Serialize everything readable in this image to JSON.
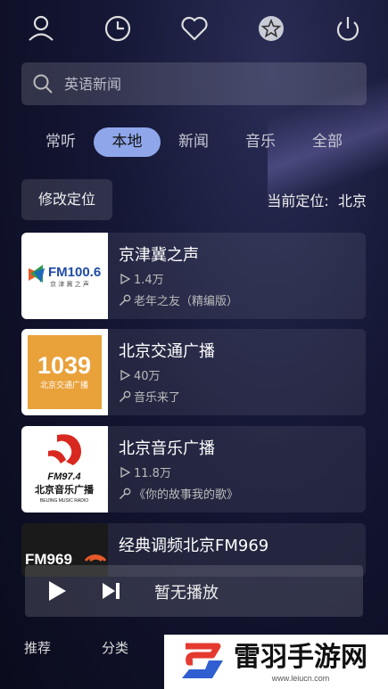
{
  "top_icons": [
    "user-icon",
    "clock-icon",
    "heart-icon",
    "star-icon",
    "power-icon"
  ],
  "search": {
    "placeholder": "英语新闻"
  },
  "tabs": [
    {
      "label": "常听",
      "active": false
    },
    {
      "label": "本地",
      "active": true
    },
    {
      "label": "新闻",
      "active": false
    },
    {
      "label": "音乐",
      "active": false
    },
    {
      "label": "全部",
      "active": false
    }
  ],
  "location": {
    "button_label": "修改定位",
    "current_label": "当前定位:",
    "current_value": "北京"
  },
  "stations": [
    {
      "title": "京津冀之声",
      "listeners": "1.4万",
      "program": "老年之友（精编版）",
      "logo_text": "FM100.6",
      "logo_sub": "京 津 冀 之 声"
    },
    {
      "title": "北京交通广播",
      "listeners": "40万",
      "program": "音乐来了",
      "logo_text": "1039",
      "logo_sub": "北京交通广播"
    },
    {
      "title": "北京音乐广播",
      "listeners": "11.8万",
      "program": "《你的故事我的歌》",
      "logo_text": "FM97.4",
      "logo_sub": "北京音乐广播",
      "logo_sub2": "BEIJING MUSIC RADIO"
    },
    {
      "title": "经典调频北京FM969",
      "listeners": "",
      "program": "",
      "logo_text": "FM969"
    }
  ],
  "player": {
    "status": "暂无播放"
  },
  "bottom_nav": [
    {
      "label": "推荐"
    },
    {
      "label": "分类"
    }
  ],
  "watermark": {
    "text": "雷羽手游网",
    "url": "www.leiucn.com"
  },
  "colors": {
    "accent": "#8fa7ea",
    "logo_orange": "#e9a13a",
    "logo_red": "#d8281f"
  }
}
